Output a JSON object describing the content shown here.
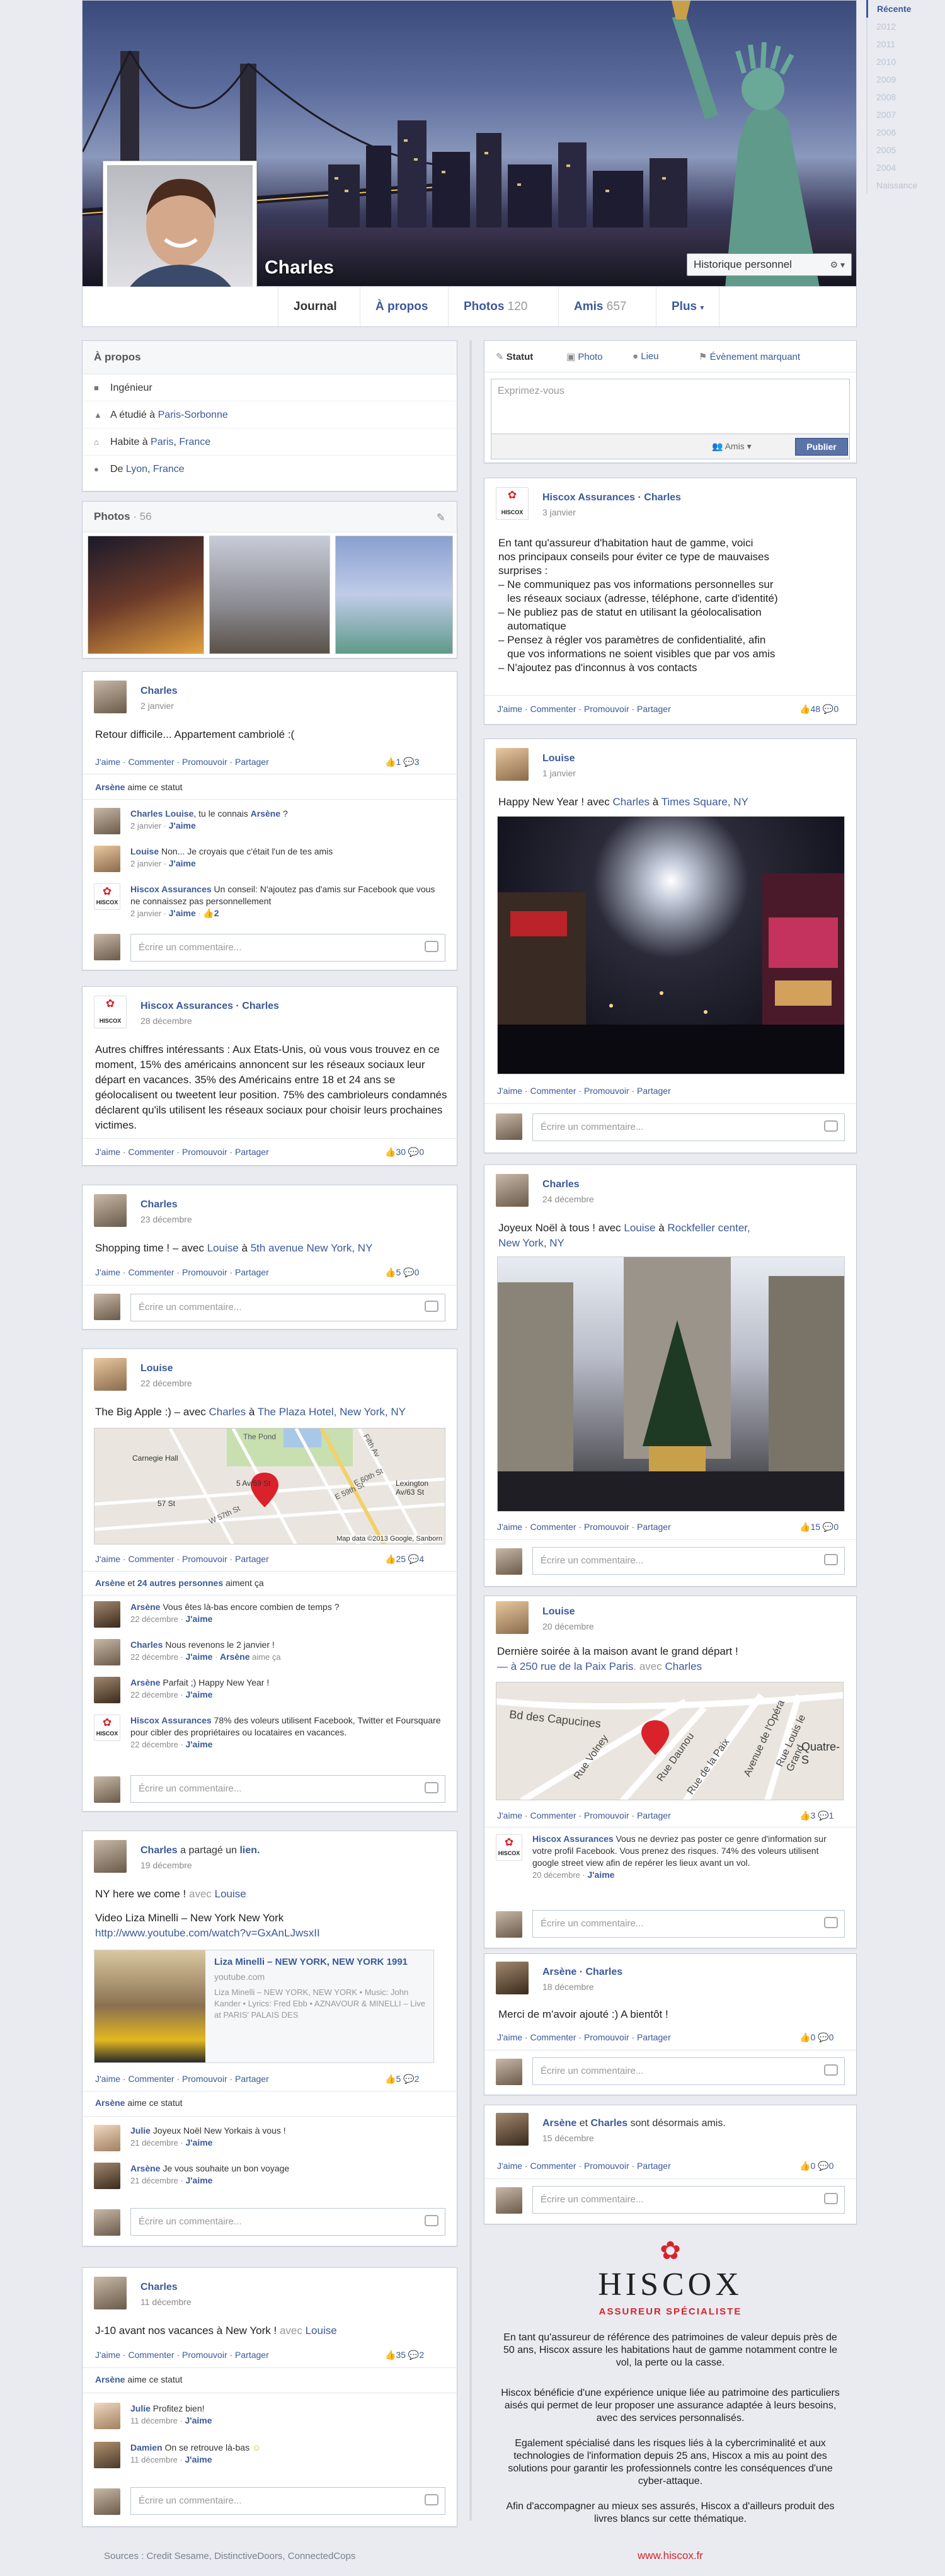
{
  "profile": {
    "name": "Charles",
    "history_button": "Historique personnel"
  },
  "nav": {
    "journal": "Journal",
    "about": "À propos",
    "photos": "Photos",
    "photos_count": "120",
    "friends": "Amis",
    "friends_count": "657",
    "more": "Plus"
  },
  "timeline": [
    "Récente",
    "2012",
    "2011",
    "2010",
    "2009",
    "2008",
    "2007",
    "2006",
    "2005",
    "2004",
    "Naissance"
  ],
  "about": {
    "title": "À propos",
    "job": "Ingénieur",
    "study_prefix": "A étudié à ",
    "study_link": "Paris-Sorbonne",
    "lives_prefix": "Habite à ",
    "lives_link1": "Paris",
    "lives_sep": ", ",
    "lives_link2": "France",
    "from_prefix": "De ",
    "from_link1": "Lyon",
    "from_sep": ", ",
    "from_link2": "France"
  },
  "photos_box": {
    "title": "Photos",
    "count": "· 56"
  },
  "composer": {
    "tab_status": "Statut",
    "tab_photo": "Photo",
    "tab_place": "Lieu",
    "tab_event": "Évènement marquant",
    "placeholder": "Exprimez-vous",
    "audience": "Amis",
    "publish": "Publier"
  },
  "common": {
    "actions": "J'aime · Commenter · Promouvoir · Partager",
    "comment_placeholder": "Écrire un commentaire...",
    "likes_status": "aime ce statut"
  },
  "posts_left": [
    {
      "name": "Charles",
      "date": "2 janvier",
      "text": "Retour difficile... Appartement cambriolé :(",
      "likes": "1",
      "comments": "3",
      "liker": "Arsène",
      "sub": [
        {
          "name": "Charles",
          "text_a": " Louise",
          "text_b": ", tu le connais ",
          "text_c": "Arsène",
          "text_d": " ?",
          "meta": "2 janvier · ",
          "meta_like": "J'aime"
        },
        {
          "name": "Louise",
          "text": " Non... Je croyais que c'était l'un de tes amis",
          "meta": "2 janvier · ",
          "meta_like": "J'aime"
        },
        {
          "name": "Hiscox Assurances",
          "text": " Un conseil: N'ajoutez pas d'amis sur Facebook que vous ne connaissez pas personnellement",
          "meta": "2 janvier · ",
          "meta_like": "J'aime",
          "meta_extra": " · ",
          "meta_count": "2"
        }
      ]
    },
    {
      "name": "Hiscox Assurances · Charles",
      "date": "28 décembre",
      "text": "Autres chiffres intéressants : Aux Etats-Unis, où vous vous trouvez en ce moment, 15% des américains annoncent sur les réseaux sociaux leur départ en vacances. 35% des Américains entre 18 et 24 ans se géolocalisent ou tweetent leur position. 75% des cambrioleurs condamnés déclarent qu'ils utilisent les réseaux sociaux pour choisir leurs prochaines victimes.",
      "likes": "30",
      "comments": "0"
    },
    {
      "name": "Charles",
      "date": "23 décembre",
      "text": "Shopping time ! – avec ",
      "text_link1": "Louise",
      "text_mid": " à ",
      "text_link2": "5th avenue New York, NY",
      "likes": "5",
      "comments": "0"
    },
    {
      "name": "Louise",
      "date": "22 décembre",
      "text": "The Big Apple :) – avec ",
      "text_link1": "Charles",
      "text_mid": " à ",
      "text_link2": "The Plaza Hotel, New York, NY",
      "map_labels": [
        "Carnegie Hall",
        "The Pond",
        "5 Av/59 St",
        "57 St",
        "W 57th St",
        "E 59th St",
        "E 60th St",
        "Lexington Av/63 St",
        "Fifth Av"
      ],
      "map_credit": "Map data ©2013 Google, Sanborn",
      "likes": "25",
      "comments": "4",
      "liker": "Arsène",
      "liker_and": " et ",
      "liker_others": "24 autres personnes",
      "liker_suffix": " aiment ça",
      "sub": [
        {
          "name": "Arsène",
          "text": " Vous êtes là-bas encore combien de temps ?",
          "meta": "22 décembre · ",
          "meta_like": "J'aime"
        },
        {
          "name": "Charles",
          "text": " Nous revenons le 2 janvier !",
          "meta": "22 décembre · ",
          "meta_like": "J'aime",
          "meta_extra": " · ",
          "meta_liker": "Arsène",
          "meta_suffix": " aime ça"
        },
        {
          "name": "Arsène",
          "text": " Parfait ;) Happy New Year !",
          "meta": "22 décembre · ",
          "meta_like": "J'aime"
        },
        {
          "name": "Hiscox Assurances",
          "text": " 78% des voleurs utilisent Facebook, Twitter et Foursquare pour cibler des propriétaires ou locataires en vacances.",
          "meta": "22 décembre · ",
          "meta_like": "J'aime"
        }
      ]
    },
    {
      "name": "Charles",
      "shared": " a partagé un ",
      "shared_link": "lien.",
      "date": "19 décembre",
      "text": "NY here we come ! ",
      "text_with": "avec ",
      "text_link1": "Louise",
      "video_title": "Video Liza Minelli – New York New York",
      "video_url": "http://www.youtube.com/watch?v=GxAnLJwsxII",
      "link_title": "Liza Minelli – NEW YORK, NEW YORK 1991",
      "link_domain": "youtube.com",
      "link_desc": "Liza Minelli – NEW YORK, NEW YORK • Music: John Kander • Lyrics: Fred Ebb • AZNAVOUR & MINELLI – Live at PARIS' PALAIS DES",
      "likes": "5",
      "comments": "2",
      "liker": "Arsène",
      "sub": [
        {
          "name": "Julie",
          "text": " Joyeux Noël New Yorkais à vous !",
          "meta": "21 décembre · ",
          "meta_like": "J'aime"
        },
        {
          "name": "Arsène",
          "text": " Je vous souhaite un bon voyage",
          "meta": "21 décembre · ",
          "meta_like": "J'aime"
        }
      ]
    },
    {
      "name": "Charles",
      "date": "11 décembre",
      "text": "J-10 avant nos vacances à New York ! ",
      "text_with": "avec ",
      "text_link1": "Louise",
      "likes": "35",
      "comments": "2",
      "liker": "Arsène",
      "sub": [
        {
          "name": "Julie",
          "text": " Profitez bien!",
          "meta": "11 décembre · ",
          "meta_like": "J'aime"
        },
        {
          "name": "Damien",
          "text": " On se retrouve là-bas",
          "meta": "11 décembre · ",
          "meta_like": "J'aime"
        }
      ]
    }
  ],
  "posts_right": [
    {
      "name": "Hiscox Assurances · Charles",
      "date": "3 janvier",
      "lines": [
        "En tant qu'assureur d'habitation haut de gamme, voici",
        "nos principaux conseils pour éviter ce type de mauvaises",
        "surprises :",
        "– Ne communiquez pas vos informations personnelles sur",
        "   les réseaux sociaux (adresse, téléphone, carte d'identité)",
        "– Ne publiez pas de statut en utilisant la géolocalisation",
        "   automatique",
        "– Pensez à régler vos paramètres de confidentialité, afin",
        "   que vos informations ne soient visibles que par vos amis",
        "– N'ajoutez pas d'inconnus à vos contacts"
      ],
      "likes": "48",
      "comments": "0"
    },
    {
      "name": "Louise",
      "date": "1 janvier",
      "text": "Happy New Year ! avec ",
      "text_link1": "Charles",
      "text_mid": " à ",
      "text_link2": "Times Square, NY"
    },
    {
      "name": "Charles",
      "date": "24 décembre",
      "text": "Joyeux Noël à tous ! avec ",
      "text_link1": "Louise",
      "text_mid": " à ",
      "text_link2": "Rockfeller center,",
      "text_link3": "New York, NY",
      "likes": "15",
      "comments": "0"
    },
    {
      "name": "Louise",
      "date": "20 décembre",
      "text": "Dernière soirée à la maison avant le grand départ !",
      "text2_a": "— à ",
      "text2_link": "250 rue de la Paix Paris",
      "text2_b": ". avec ",
      "text2_link2": "Charles",
      "map_labels": [
        "Bd des Capucines",
        "Rue Daunou",
        "Rue de la Paix",
        "Rue Volney",
        "Avenue de l'Opéra",
        "Rue Louis le Grand",
        "Quatre-S"
      ],
      "likes": "3",
      "comments": "1",
      "sub_name": "Hiscox Assurances",
      "sub_text": " Vous ne devriez pas poster ce genre d'information sur votre profil Facebook. Vous prenez des risques. 74% des voleurs utilisent google street view afin de repérer les lieux avant un vol.",
      "sub_meta": "20 décembre · ",
      "sub_like": "J'aime"
    },
    {
      "name": "Arsène · Charles",
      "date": "18 décembre",
      "text": "Merci de m'avoir ajouté :) A bientôt !",
      "likes": "0",
      "comments": "0"
    },
    {
      "name_a": "Arsène",
      "name_and": " et ",
      "name_b": "Charles",
      "name_suffix": " sont désormais amis.",
      "date": "15 décembre",
      "likes": "0",
      "comments": "0"
    }
  ],
  "hiscox": {
    "brand": "HISCOX",
    "tagline": "ASSUREUR SPÉCIALISTE",
    "p1": "En tant qu'assureur de référence des patrimoines de valeur depuis près de 50 ans, Hiscox assure les habitations haut de gamme notamment contre le vol, la perte ou la casse.",
    "p2": "Hiscox bénéficie d'une expérience unique liée au patrimoine des particuliers aisés qui permet de leur proposer une assurance adaptée à leurs besoins, avec des services personnalisés.",
    "p3": "Egalement spécialisé dans les risques liés à la cybercriminalité et aux technologies de l'information depuis 25 ans, Hiscox a mis au point des solutions pour garantir les professionnels contre les conséquences d'une cyber-attaque.",
    "p4": "Afin d'accompagner au mieux ses assurés, Hiscox a d'ailleurs produit des livres blancs sur cette thématique.",
    "url": "www.hiscox.fr"
  },
  "footer": {
    "sources": "Sources : Credit Sesame, DistinctiveDoors, ConnectedCops"
  }
}
